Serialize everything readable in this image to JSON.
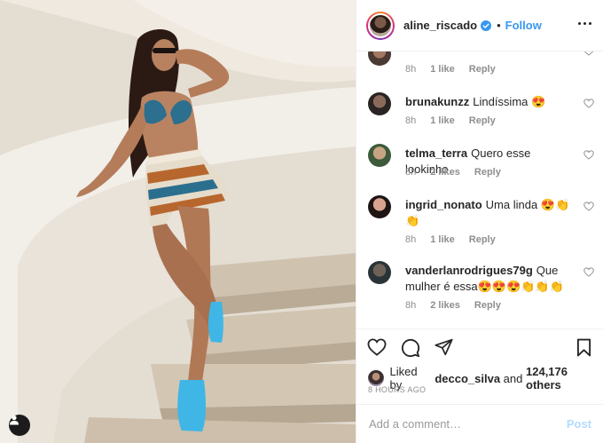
{
  "header": {
    "username": "aline_riscado",
    "separator": "•",
    "follow_label": "Follow"
  },
  "comments": [
    {
      "username": "",
      "text": "",
      "time": "8h",
      "likes": "1 like",
      "reply": "Reply"
    },
    {
      "username": "brunakunzz",
      "text": "Lindíssima 😍",
      "time": "8h",
      "likes": "1 like",
      "reply": "Reply"
    },
    {
      "username": "telma_terra",
      "text": "Quero esse lookinho",
      "time": "8h",
      "likes": "2 likes",
      "reply": "Reply"
    },
    {
      "username": "ingrid_nonato",
      "text": "Uma linda 😍👏👏",
      "time": "8h",
      "likes": "1 like",
      "reply": "Reply"
    },
    {
      "username": "vanderlanrodrigues79g",
      "text": "Que mulher é essa😍😍😍👏👏👏",
      "time": "8h",
      "likes": "2 likes",
      "reply": "Reply"
    }
  ],
  "likes": {
    "prefix": "Liked by",
    "user": "decco_silva",
    "and": "and",
    "others": "124,176 others"
  },
  "timestamp": "8 HOURS AGO",
  "add_comment": {
    "placeholder": "Add a comment…",
    "post_label": "Post"
  },
  "colors": {
    "link_blue": "#3897f0",
    "post_disabled": "#b3dbff",
    "meta_gray": "#8e8e8e",
    "border": "#efefef"
  },
  "icons": [
    "verified-badge-icon",
    "more-options-icon",
    "heart-icon",
    "comment-icon",
    "share-icon",
    "bookmark-icon",
    "user-tag-icon"
  ]
}
